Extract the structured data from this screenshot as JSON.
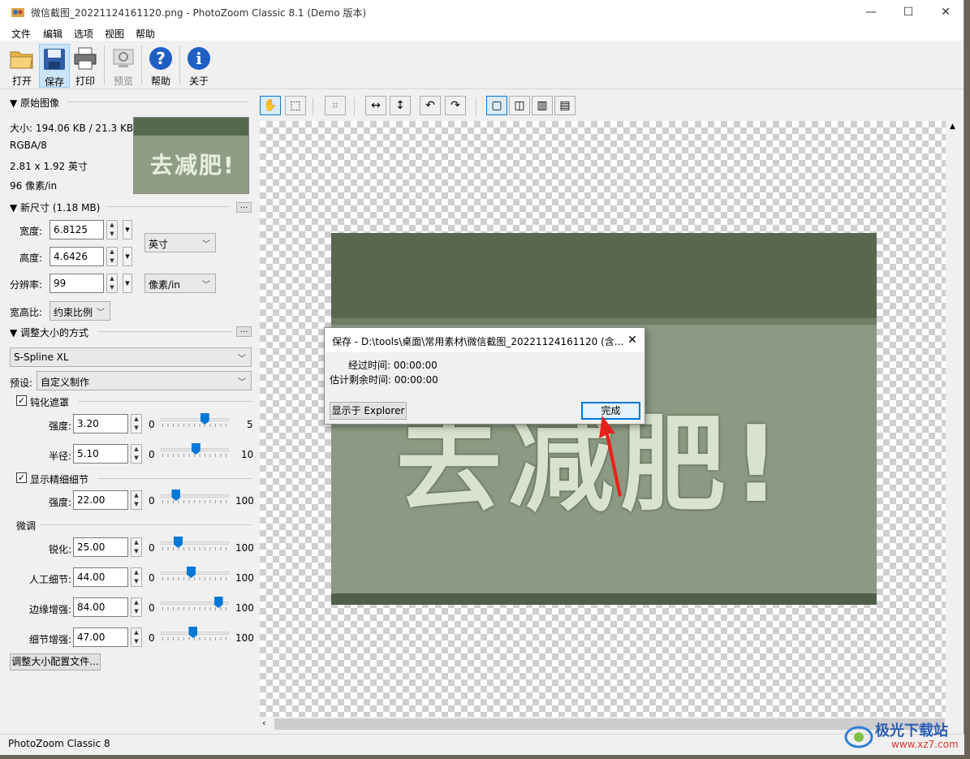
{
  "window": {
    "title": "微信截图_20221124161120.png - PhotoZoom Classic 8.1 (Demo 版本)",
    "minimize": "—",
    "maximize": "☐",
    "close": "✕"
  },
  "menu": [
    "文件",
    "编辑",
    "选项",
    "视图",
    "帮助"
  ],
  "toolbar": [
    {
      "label": "打开",
      "icon": "open-folder-icon"
    },
    {
      "label": "保存",
      "icon": "save-disk-icon"
    },
    {
      "label": "打印",
      "icon": "printer-icon"
    },
    {
      "label": "预览",
      "icon": "preview-icon"
    },
    {
      "label": "帮助",
      "icon": "help-icon"
    },
    {
      "label": "关于",
      "icon": "info-icon"
    }
  ],
  "original": {
    "header": "▼ 原始图像",
    "size": "大小: 194.06 KB / 21.3 KB",
    "mode": "RGBA/8",
    "dimensions": "2.81 x 1.92 英寸",
    "resolution": "96 像素/in",
    "thumb_text": "去减肥!"
  },
  "newsize": {
    "header": "▼ 新尺寸 (1.18 MB)",
    "more": "...",
    "width_label": "宽度:",
    "width_value": "6.8125",
    "height_label": "高度:",
    "height_value": "4.6426",
    "res_label": "分辨率:",
    "res_value": "99",
    "unit_size": "英寸",
    "unit_res": "像素/in",
    "aspect_label": "宽高比:",
    "aspect_value": "约束比例"
  },
  "method": {
    "header": "▼ 调整大小的方式",
    "more": "...",
    "algorithm": "S-Spline XL",
    "preset_label": "预设:",
    "preset_value": "自定义制作",
    "unsharp_label": "钝化遮罩",
    "unsharp_checked": "✓",
    "strength_label": "强度:",
    "strength_value": "3.20",
    "strength_min": "0",
    "strength_max": "5",
    "strength_frac": 0.64,
    "radius_label": "半径:",
    "radius_value": "5.10",
    "radius_min": "0",
    "radius_max": "10",
    "radius_frac": 0.51,
    "detail_label": "显示精细细节",
    "detail_checked": "✓",
    "detail_strength_label": "强度:",
    "detail_strength_value": "22.00",
    "detail_min": "0",
    "detail_max": "100",
    "detail_frac": 0.22,
    "finetune_header": "微调",
    "sharpen_label": "锐化:",
    "sharpen_value": "25.00",
    "sharpen_frac": 0.25,
    "artifact_label": "人工细节:",
    "artifact_value": "44.00",
    "artifact_frac": 0.44,
    "edge_label": "边缘增强:",
    "edge_value": "84.00",
    "edge_frac": 0.84,
    "detailboost_label": "细节增强:",
    "detailboost_value": "47.00",
    "detailboost_frac": 0.47,
    "min": "0",
    "max": "100",
    "profile_button": "调整大小配置文件..."
  },
  "image_text": "去减肥!",
  "dialog": {
    "title": "保存 - D:\\tools\\桌面\\常用素材\\微信截图_20221124161120 (含...",
    "elapsed": "经过时间: 00:00:00",
    "remaining": "估计剩余时间: 00:00:00",
    "explorer_button": "显示于 Explorer",
    "done_button": "完成",
    "close": "✕"
  },
  "statusbar": {
    "text": "PhotoZoom Classic 8"
  },
  "watermark": {
    "brand": "极光下载站",
    "url": "www.xz7.com"
  },
  "colors": {
    "accent": "#0078d7",
    "arrow": "#e8211c"
  }
}
